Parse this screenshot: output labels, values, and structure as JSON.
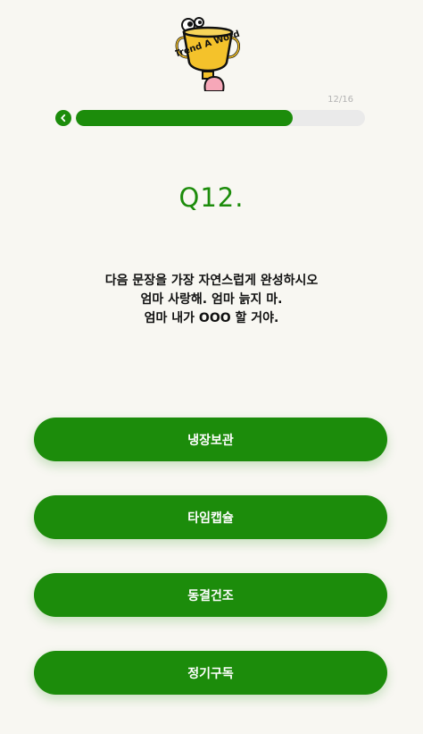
{
  "logo": {
    "icon": "trophy-mascot-icon",
    "text": "Trend A Word"
  },
  "progress": {
    "label": "12/16",
    "current": 12,
    "total": 16,
    "fraction": 0.75
  },
  "nav": {
    "back_icon": "chevron-left-icon"
  },
  "question": {
    "number": "Q12.",
    "lines": [
      "다음 문장을 가장 자연스럽게 완성하시오",
      "엄마 사랑해. 엄마 늙지 마.",
      "엄마 내가 OOO 할 거야."
    ]
  },
  "answers": [
    {
      "label": "냉장보관"
    },
    {
      "label": "타임캡슐"
    },
    {
      "label": "동결건조"
    },
    {
      "label": "정기구독"
    }
  ],
  "colors": {
    "accent": "#1c8c0b",
    "background": "#f8f7f2",
    "track": "#eaeaea",
    "counter": "#b3b3b3"
  }
}
